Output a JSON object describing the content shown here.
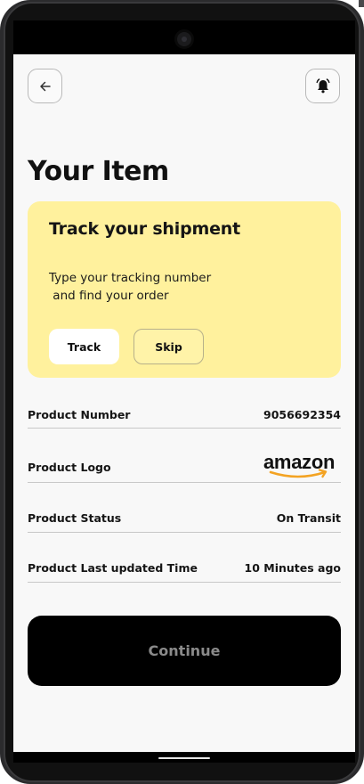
{
  "header": {
    "back_icon": "arrow-left-icon",
    "bell_icon": "bell-ring-icon"
  },
  "page": {
    "title": "Your Item"
  },
  "tracking_card": {
    "title": "Track your shipment",
    "description": "Type your tracking number\n and find your order",
    "track_label": "Track",
    "skip_label": "Skip",
    "background": "#fff19d"
  },
  "details": [
    {
      "label": "Product Number",
      "value": "9056692354"
    },
    {
      "label": "Product Logo",
      "value": "amazon"
    },
    {
      "label": "Product Status",
      "value": "On Transit"
    },
    {
      "label": "Product Last updated Time",
      "value": "10 Minutes ago"
    }
  ],
  "footer": {
    "continue_label": "Continue"
  },
  "colors": {
    "accent": "#fff19d",
    "logo_orange": "#f3a323",
    "primary_button": "#000000"
  }
}
